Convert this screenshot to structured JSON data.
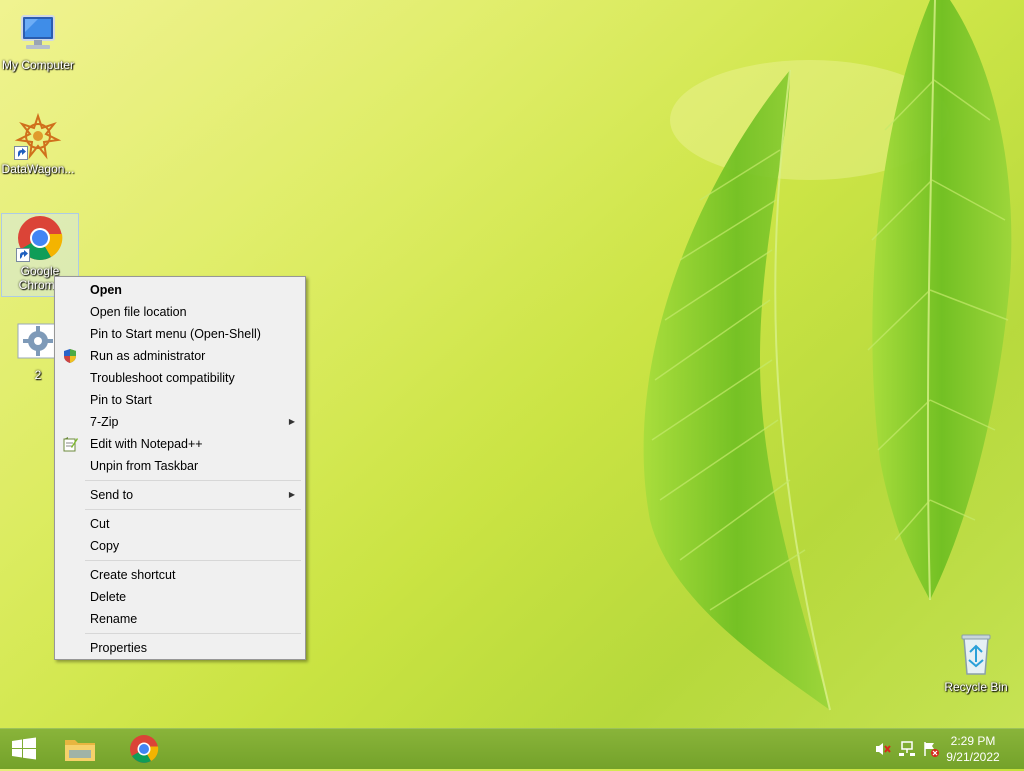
{
  "desktop": {
    "icons": [
      {
        "label": "My Computer"
      },
      {
        "label": "DataWagon..."
      },
      {
        "label": "Google Chrome"
      },
      {
        "label": "2"
      },
      {
        "label": "Recycle Bin"
      }
    ]
  },
  "context_menu": {
    "items": {
      "open": "Open",
      "open_file_location": "Open file location",
      "pin_start_menu": "Pin to Start menu (Open-Shell)",
      "run_as_admin": "Run as administrator",
      "troubleshoot": "Troubleshoot compatibility",
      "pin_to_start": "Pin to Start",
      "seven_zip": "7-Zip",
      "edit_notepad": "Edit with Notepad++",
      "unpin_taskbar": "Unpin from Taskbar",
      "send_to": "Send to",
      "cut": "Cut",
      "copy": "Copy",
      "create_shortcut": "Create shortcut",
      "delete": "Delete",
      "rename": "Rename",
      "properties": "Properties"
    }
  },
  "taskbar": {
    "clock_time": "2:29 PM",
    "clock_date": "9/21/2022"
  },
  "colors": {
    "taskbar": "#7aa82e",
    "menu_bg": "#f0f0f0",
    "leaf": "#7cc52a"
  }
}
